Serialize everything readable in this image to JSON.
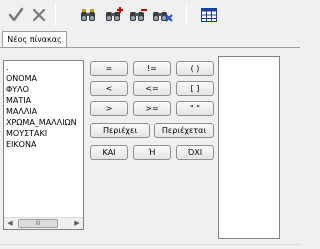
{
  "toolbar": {
    "icons": [
      "checkmark-icon",
      "close-icon",
      "binoculars-icon",
      "binoculars-add-icon",
      "binoculars-remove-icon",
      "binoculars-clear-icon",
      "table-icon"
    ]
  },
  "tabs": [
    {
      "label": "Νέος πίνακας"
    }
  ],
  "fields": [
    ".",
    "ΟΝΟΜΑ",
    "ΦΥΛΟ",
    "ΜΑΤΙΑ",
    "ΜΑΛΛΙΑ",
    "ΧΡΩΜΑ_ΜΑΛΛΙΩΝ",
    "ΜΟΥΣΤΑΚΙ",
    "ΕΙΚΟΝΑ"
  ],
  "operators": {
    "eq": "=",
    "neq": "!=",
    "parens": "( )",
    "lt": "<",
    "lte": "<=",
    "brackets": "[ ]",
    "gt": ">",
    "gte": ">=",
    "quotes": "\" \"",
    "contains": "Περιέχει",
    "contained": "Περιέχεται",
    "and": "ΚΑΙ",
    "or": "Ή",
    "not": "ΌΧΙ"
  },
  "scrollbar": {
    "left_arrow": "◀",
    "right_arrow": "▶",
    "thumb_grip": "III"
  }
}
